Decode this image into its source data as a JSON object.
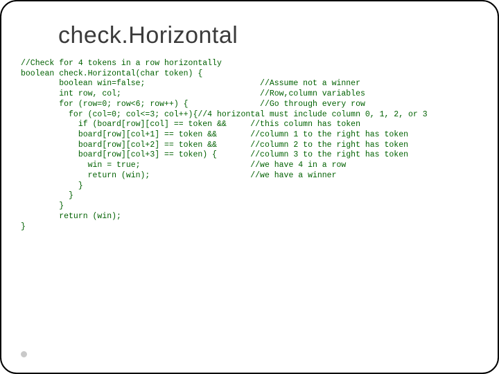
{
  "title": "check.Horizontal",
  "code_lines": [
    "//Check for 4 tokens in a row horizontally",
    "boolean check.Horizontal(char token) {",
    "        boolean win=false;                        //Assume not a winner",
    "        int row, col;                             //Row,column variables",
    "        for (row=0; row<6; row++) {               //Go through every row",
    "          for (col=0; col<=3; col++){//4 horizontal must include column 0, 1, 2, or 3",
    "            if (board[row][col] == token &&     //this column has token",
    "            board[row][col+1] == token &&       //column 1 to the right has token",
    "            board[row][col+2] == token &&       //column 2 to the right has token",
    "            board[row][col+3] == token) {       //column 3 to the right has token",
    "              win = true;                       //we have 4 in a row",
    "              return (win);                     //we have a winner",
    "            }",
    "          }",
    "        }",
    "        return (win);",
    "}"
  ]
}
